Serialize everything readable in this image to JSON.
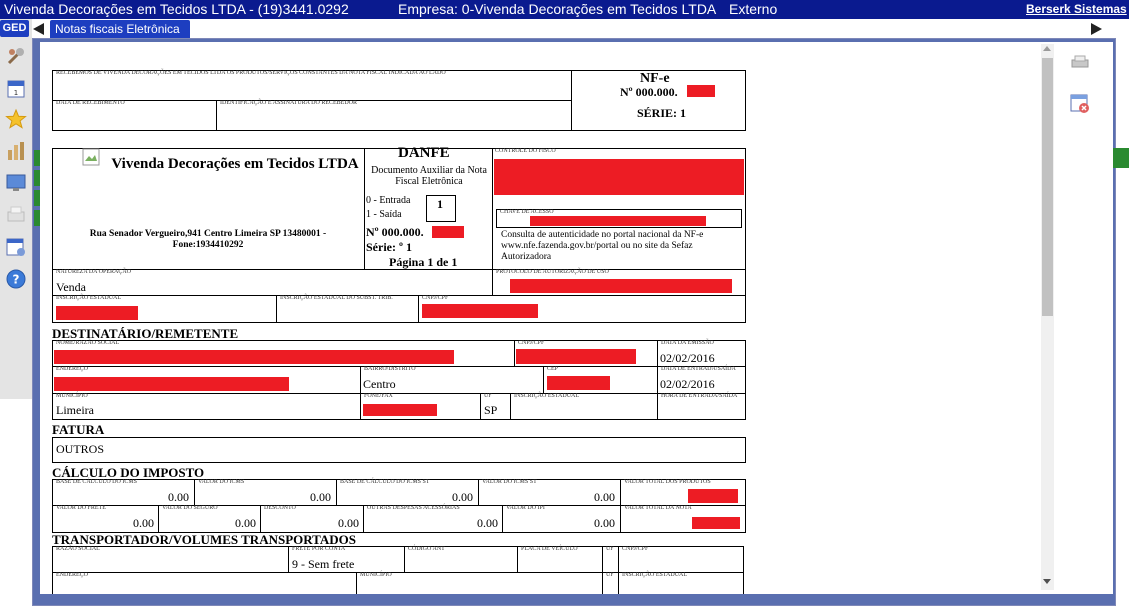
{
  "header": {
    "title": "Vivenda Decorações em Tecidos LTDA - (19)3441.0292",
    "empresa": "Empresa: 0-Vivenda Decorações em Tecidos LTDA",
    "mode": "Externo",
    "brand_link": "Berserk Sistemas"
  },
  "sidebar": {
    "ged_label": "GED"
  },
  "tab": {
    "label": "Notas fiscais Eletrônica"
  },
  "colors": {
    "topbar": "#0a1a8f",
    "tab": "#1d3ec0",
    "redaction": "#ed1c24",
    "frame": "#5a6fb0"
  },
  "danfe": {
    "canhoto": {
      "received_text": "RECEBEMOS DE VIVENDA DECORAÇÕES EM TECIDOS LTDA OS PRODUTOS/SERVIÇOS CONSTANTES DA NOTA FISCAL INDICADA AO LADO",
      "date_label": "DATA DE RECEBIMENTO",
      "sign_label": "IDENTIFICAÇÃO E ASSINATURA DO RECEBEDOR",
      "nfe_title": "NF-e",
      "nfe_number": "Nº 000.000.",
      "serie": "SÉRIE: 1"
    },
    "emitente": {
      "name": "Vivenda Decorações em Tecidos LTDA",
      "address": "Rua Senador Vergueiro,941 Centro Limeira SP 13480001 - Fone:1934410292"
    },
    "danfe_box": {
      "title": "DANFE",
      "subtitle": "Documento Auxiliar da Nota Fiscal Eletrônica",
      "entrada": "0 - Entrada",
      "saida": "1 - Saída",
      "type_value": "1",
      "number": "Nº 000.000.",
      "serie": "Série: º 1",
      "page": "Página 1 de 1"
    },
    "fisco": {
      "controle_label": "CONTROLE DO FISCO",
      "chave_label": "CHAVE DE ACESSO",
      "consulta": "Consulta de autenticidade no portal nacional da NF-e www.nfe.fazenda.gov.br/portal ou no site da Sefaz Autorizadora"
    },
    "operacao": {
      "natureza_label": "NATUREZA DA OPERAÇÃO",
      "natureza_value": "Venda",
      "protocolo_label": "PROTOCOLO DE AUTORIZAÇÃO DE USO",
      "ie_label": "INSCRIÇÃO ESTADUAL",
      "ie_st_label": "INSCRIÇÃO ESTADUAL DO SUBST. TRIB.",
      "cnpj_label": "CNPJ/CPF"
    },
    "destinatario": {
      "section": "DESTINATÁRIO/REMETENTE",
      "nome_label": "NOME/RAZÃO SOCIAL",
      "cnpj_label": "CNPJ/CPF",
      "emissao_label": "DATA DA EMISSÃO",
      "emissao_value": "02/02/2016",
      "endereco_label": "ENDEREÇO",
      "bairro_label": "BAIRRO/DISTRITO",
      "bairro_value": "Centro",
      "cep_label": "CEP",
      "entrada_label": "DATA DE ENTRADA/SAÍDA",
      "entrada_value": "02/02/2016",
      "municipio_label": "MUNICÍPIO",
      "municipio_value": "Limeira",
      "fone_label": "FONE/FAX",
      "uf_label": "UF",
      "uf_value": "SP",
      "ie_label": "INSCRIÇÃO ESTADUAL",
      "hora_label": "HORA DE ENTRADA/SAÍDA"
    },
    "fatura": {
      "section": "FATURA",
      "value": "OUTROS"
    },
    "imposto": {
      "section": "CÁLCULO DO IMPOSTO",
      "base_icms_label": "BASE DE CÁLCULO DO ICMS",
      "base_icms": "0.00",
      "valor_icms_label": "VALOR DO ICMS",
      "valor_icms": "0.00",
      "base_st_label": "BASE DE CÁLCULO DO ICMS ST",
      "base_st": "0.00",
      "valor_st_label": "VALOR DO ICMS ST",
      "valor_st": "0.00",
      "total_produtos_label": "VALOR TOTAL DOS PRODUTOS",
      "frete_label": "VALOR DO FRETE",
      "frete": "0.00",
      "seguro_label": "VALOR DO SEGURO",
      "seguro": "0.00",
      "desconto_label": "DESCONTO",
      "desconto": "0.00",
      "outras_label": "OUTRAS DESPESAS ACESSÓRIAS",
      "outras": "0.00",
      "ipi_label": "VALOR DO IPI",
      "ipi": "0.00",
      "total_nota_label": "VALOR TOTAL DA NOTA"
    },
    "transportador": {
      "section": "TRANSPORTADOR/VOLUMES TRANSPORTADOS",
      "razao_label": "RAZÃO SOCIAL",
      "frete_label": "FRETE POR CONTA",
      "frete_value": "9 - Sem frete",
      "antt_label": "CÓDIGO ANT",
      "placa_label": "PLACA DE VEÍCULO",
      "uf_label": "UF",
      "cnpj_label": "CNPJ/CPF",
      "endereco_label": "ENDEREÇO",
      "municipio_label": "MUNICÍPIO",
      "uf2_label": "UF",
      "ie_label": "INSCRIÇÃO ESTADUAL"
    }
  }
}
